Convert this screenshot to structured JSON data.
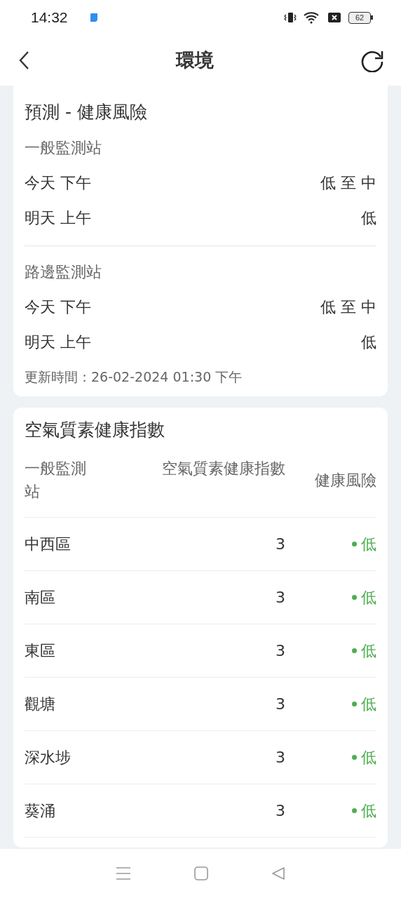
{
  "status_bar": {
    "time": "14:32",
    "battery_text": "62"
  },
  "header": {
    "title": "環境"
  },
  "forecast": {
    "title": "預測 - 健康風險",
    "groups": [
      {
        "name": "一般監測站",
        "rows": [
          {
            "period": "今天 下午",
            "risk": "低 至 中"
          },
          {
            "period": "明天 上午",
            "risk": "低"
          }
        ]
      },
      {
        "name": "路邊監測站",
        "rows": [
          {
            "period": "今天 下午",
            "risk": "低 至 中"
          },
          {
            "period": "明天 上午",
            "risk": "低"
          }
        ]
      }
    ],
    "updated": "更新時間：26-02-2024 01:30 下午"
  },
  "aqhi": {
    "title": "空氣質素健康指數",
    "columns": [
      "一般監測站",
      "空氣質素健康指數",
      "健康風險"
    ],
    "rows": [
      {
        "station": "中西區",
        "index": "3",
        "risk": "低",
        "color": "#4caf50"
      },
      {
        "station": "南區",
        "index": "3",
        "risk": "低",
        "color": "#4caf50"
      },
      {
        "station": "東區",
        "index": "3",
        "risk": "低",
        "color": "#4caf50"
      },
      {
        "station": "觀塘",
        "index": "3",
        "risk": "低",
        "color": "#4caf50"
      },
      {
        "station": "深水埗",
        "index": "3",
        "risk": "低",
        "color": "#4caf50"
      },
      {
        "station": "葵涌",
        "index": "3",
        "risk": "低",
        "color": "#4caf50"
      }
    ]
  }
}
